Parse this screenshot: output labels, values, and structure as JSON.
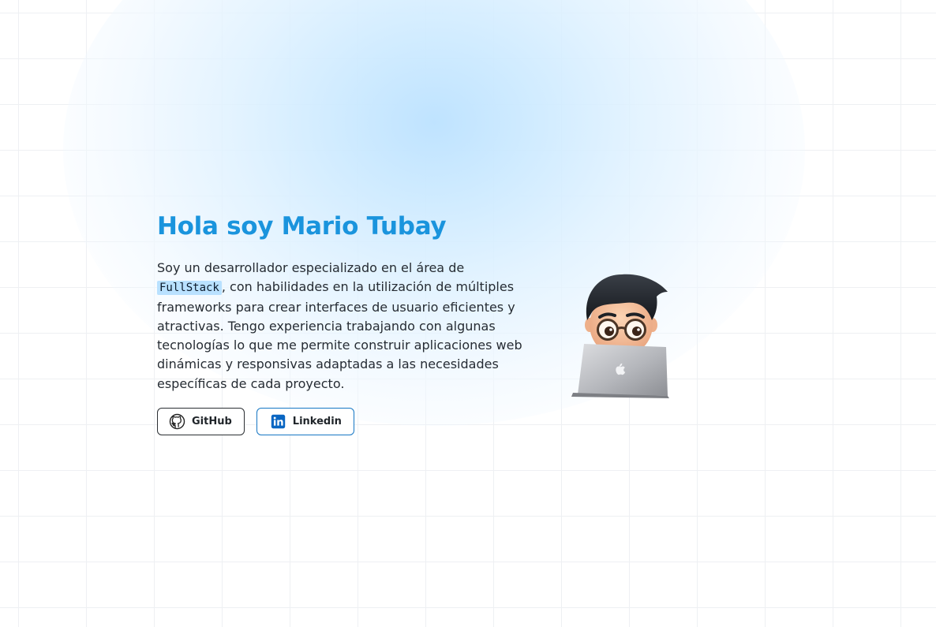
{
  "hero": {
    "title": "Hola soy Mario Tubay",
    "bio_before": "Soy un desarrollador especializado en el área de ",
    "bio_highlight": "FullStack",
    "bio_after": ", con habilidades en la utilización de múltiples frameworks para crear interfaces de usuario eficientes y atractivas. Tengo experiencia trabajando con algunas tecnologías lo que me permite construir aplicaciones web dinámicas y responsivas adaptadas a las necesidades específicas de cada proyecto."
  },
  "buttons": [
    {
      "label": "GitHub",
      "icon": "github-icon"
    },
    {
      "label": "Linkedin",
      "icon": "linkedin-icon"
    }
  ],
  "avatar": {
    "icon": "memoji-laptop-avatar"
  },
  "colors": {
    "title": "#1a94dd",
    "highlight_bg": "#b9e1ff",
    "linkedin_blue": "#0a66c2",
    "text": "#262c33",
    "grid": "#eef0f3"
  }
}
